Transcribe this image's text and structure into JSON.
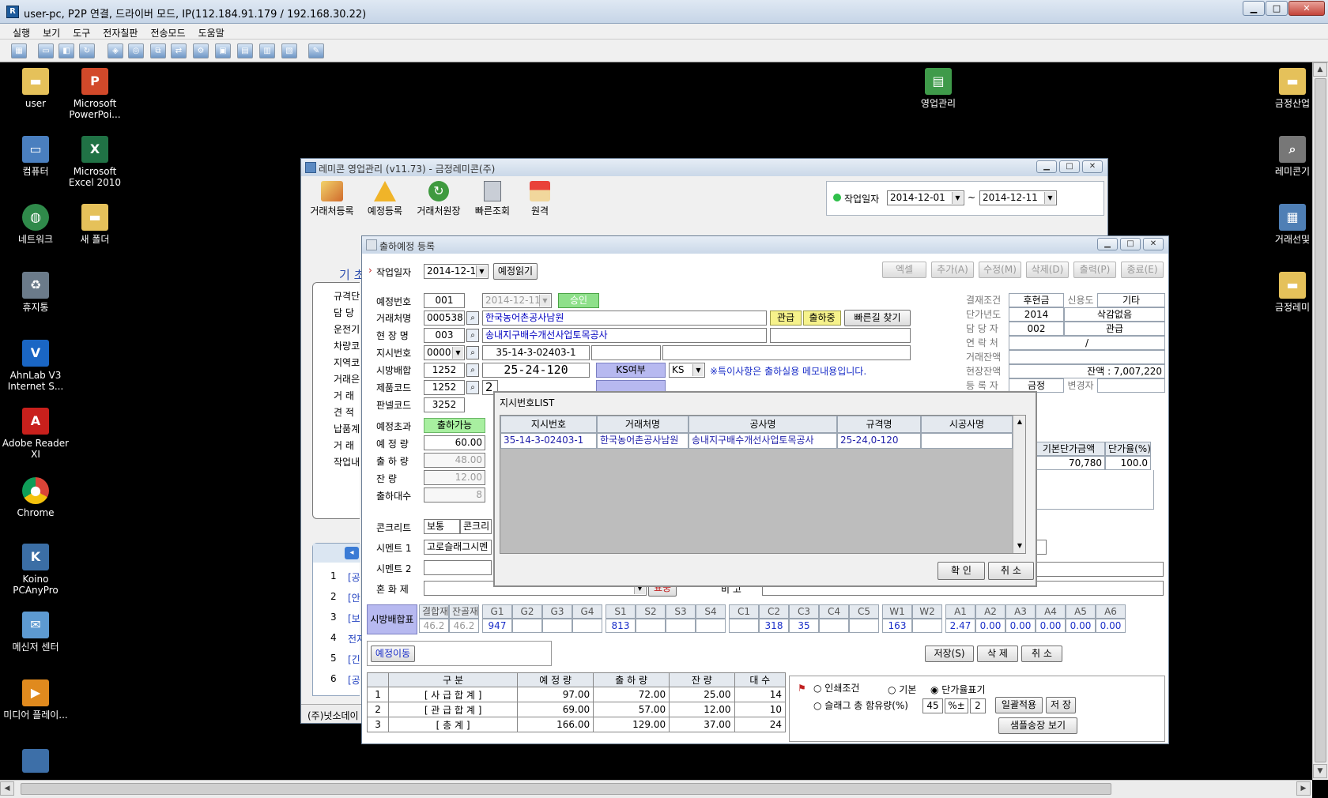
{
  "remote": {
    "title": "user-pc, P2P 연결, 드라이버 모드, IP(112.184.91.179 / 192.168.30.22)",
    "menu": [
      "실행",
      "보기",
      "도구",
      "전자칠판",
      "전송모드",
      "도움말"
    ]
  },
  "desktop": {
    "icons_left": [
      {
        "label": "user",
        "icon": "folder-icon"
      },
      {
        "label": "Microsoft PowerPoi...",
        "icon": "powerpoint-icon"
      },
      {
        "label": "컴퓨터",
        "icon": "computer-icon"
      },
      {
        "label": "Microsoft Excel 2010",
        "icon": "excel-icon"
      },
      {
        "label": "네트워크",
        "icon": "network-icon"
      },
      {
        "label": "새 폴더",
        "icon": "folder-icon"
      },
      {
        "label": "휴지통",
        "icon": "recycle-bin-icon"
      },
      {
        "label": "AhnLab V3 Internet S...",
        "icon": "v3-icon"
      },
      {
        "label": "Adobe Reader XI",
        "icon": "acrobat-icon"
      },
      {
        "label": "Chrome",
        "icon": "chrome-icon"
      },
      {
        "label": "Koino PCAnyPro",
        "icon": "koino-icon"
      },
      {
        "label": "메신저 센터",
        "icon": "messenger-icon"
      },
      {
        "label": "미디어 플레이...",
        "icon": "media-player-icon"
      }
    ],
    "icon_center": {
      "label": "영업관리",
      "icon": "app-shortcut-icon"
    },
    "icons_right": [
      {
        "label": "금정산업",
        "icon": "folder-icon"
      },
      {
        "label": "레미콘기",
        "icon": "search-icon"
      },
      {
        "label": "거래선및",
        "icon": "shortcut-icon"
      },
      {
        "label": "금정레미",
        "icon": "folder-icon"
      }
    ]
  },
  "main_window": {
    "title": "레미콘 영업관리 (v11.73) - 금정레미콘(주)",
    "toolbar": [
      "거래처등록",
      "예정등록",
      "거래처원장",
      "빠른조회",
      "원격"
    ],
    "work_date_label": "작업일자",
    "date_from": "2014-12-01",
    "date_sep": "~",
    "date_to": "2014-12-11",
    "side_heading": "기 초",
    "side_labels": [
      "규격단",
      "담 당",
      "운전기",
      "차량코",
      "지역코",
      "거래은",
      "거 래",
      "견 적",
      "납품계",
      "거 래",
      "작업내"
    ],
    "bottom_list": [
      "1",
      "[공",
      "2",
      "[안",
      "3",
      "[보",
      "4",
      "전지",
      "5",
      "[긴",
      "6",
      "[공"
    ],
    "status_text": "(주)넛소데이"
  },
  "form": {
    "title": "출하예정 등록",
    "work_date_label": "작업일자",
    "work_date": "2014-12-11",
    "read_button": "예정읽기",
    "actions": [
      "엑셀",
      "추가(A)",
      "수정(M)",
      "삭제(D)",
      "출력(P)",
      "종료(E)"
    ],
    "labels": {
      "plan_no": "예정번호",
      "client": "거래처명",
      "site": "현 장 명",
      "instr": "지시번호",
      "mix": "시방배합",
      "product": "제품코드",
      "panel": "판넬코드"
    },
    "plan_no": "001",
    "plan_date": "2014-12-11",
    "approved": "승인",
    "client_code": "000538",
    "client_name": "한국농어촌공사남원",
    "tag_gwangeup": "관급",
    "tag_shipping": "출하중",
    "find_route": "빠른길 찾기",
    "site_code": "003",
    "site_name": "송내지구배수개선사업토목공사",
    "instr_code": "0000",
    "instr_no": "35-14-3-02403-1",
    "mix_code": "1252",
    "mix_spec": "25-24-120",
    "ks_label": "KS여부",
    "ks_value": "KS",
    "special_note": "※특이사항은 출하실용 메모내용입니다.",
    "product_code": "1252",
    "panel_code": "3252",
    "product_partial": "2",
    "right_info": {
      "labels": [
        "결재조건",
        "단가년도",
        "담 당 자",
        "연 락 처",
        "거래잔액",
        "현장잔액",
        "등 록 자"
      ],
      "pay": "후현금",
      "credit_label": "신용도",
      "credit": "기타",
      "year": "2014",
      "discount": "삭감없음",
      "manager_code": "002",
      "manager": "관급",
      "contact": "/",
      "site_balance": "잔액 : 7,007,220",
      "registrant": "금정",
      "changer_label": "변경자"
    },
    "qty": {
      "over_label": "예정초과",
      "over_value": "출하가능",
      "plan_label": "예 정 량",
      "plan": "60.00",
      "ship_label": "출 하 량",
      "ship": "48.00",
      "rest_label": "잔 량",
      "rest": "12.00",
      "count_label": "출하대수",
      "count": "8"
    },
    "price": {
      "base_label": "기본단가금액",
      "base": "70,780",
      "rate_label": "단가율(%)",
      "rate": "100.0"
    },
    "concrete_label": "콘크리트",
    "concrete_value": "보통",
    "concrete_partial": "콘크리",
    "cement1_label": "시멘트 1",
    "cement1_value": "고로슬래그시멘",
    "cement2_label": "시멘트 2",
    "admix_label": "혼 화 제",
    "pyo_button": "표쭝",
    "remark_label": "비 고",
    "right_partial": ".5",
    "mix_table": {
      "label": "시방배합표",
      "headers": [
        "결합재비",
        "잔골재율",
        "G1",
        "G2",
        "G3",
        "G4",
        "S1",
        "S2",
        "S3",
        "S4",
        "C1",
        "C2",
        "C3",
        "C4",
        "C5",
        "W1",
        "W2",
        "A1",
        "A2",
        "A3",
        "A4",
        "A5",
        "A6"
      ],
      "values": [
        "46.2",
        "46.2",
        "947",
        "",
        "",
        "",
        "813",
        "",
        "",
        "",
        "",
        "318",
        "35",
        "",
        "",
        "163",
        "",
        "2.47",
        "0.00",
        "0.00",
        "0.00",
        "0.00",
        "0.00"
      ]
    },
    "move_button": "예정이동",
    "save_button": "저장(S)",
    "delete_button": "삭 제",
    "cancel_button": "취 소",
    "summary": {
      "headers": [
        "",
        "구 분",
        "예 정 량",
        "출 하 량",
        "잔 량",
        "대 수"
      ],
      "rows": [
        [
          "1",
          "[ 사 급 합 계 ]",
          "97.00",
          "72.00",
          "25.00",
          "14"
        ],
        [
          "2",
          "[ 관 급 합 계 ]",
          "69.00",
          "57.00",
          "12.00",
          "10"
        ],
        [
          "3",
          "[ 총 계 ]",
          "166.00",
          "129.00",
          "37.00",
          "24"
        ]
      ]
    },
    "print": {
      "cond_label": "인쇄조건",
      "basic": "기본",
      "rate_mark": "단가율표기",
      "slag_label": "슬래그 총 함유량(%)",
      "slag_value": "45",
      "pct_pm": "%±",
      "pm_value": "2",
      "apply": "일괄적용",
      "save": "저 장",
      "sample": "샘플송장 보기"
    }
  },
  "dialog": {
    "title": "지시번호LIST",
    "headers": [
      "지시번호",
      "거래처명",
      "공사명",
      "규격명",
      "시공사명"
    ],
    "rows": [
      [
        "35-14-3-02403-1",
        "한국농어촌공사남원",
        "송내지구배수개선사업토목공사",
        "25-24,0-120",
        ""
      ]
    ],
    "ok": "확 인",
    "cancel": "취 소"
  }
}
